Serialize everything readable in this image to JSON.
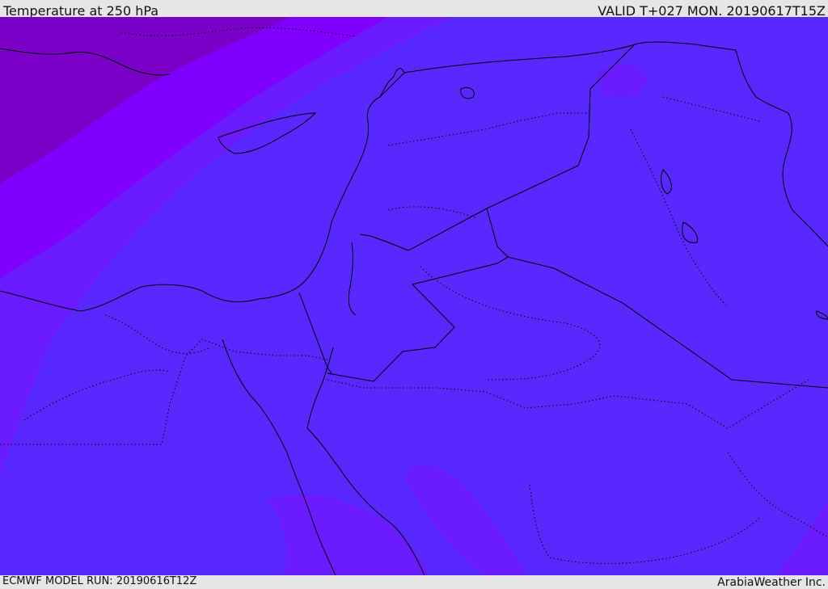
{
  "header": {
    "title": "Temperature at 250 hPa",
    "valid_time": "VALID T+027 MON. 20190617T15Z"
  },
  "footer": {
    "model_run": "ECMWF MODEL RUN: 20190616T12Z",
    "credit": "ArabiaWeather Inc."
  },
  "colors": {
    "coldest": "#7a00c8",
    "colder": "#8000ff",
    "mid": "#6a1bff",
    "main": "#5828ff",
    "border": "#000000"
  }
}
